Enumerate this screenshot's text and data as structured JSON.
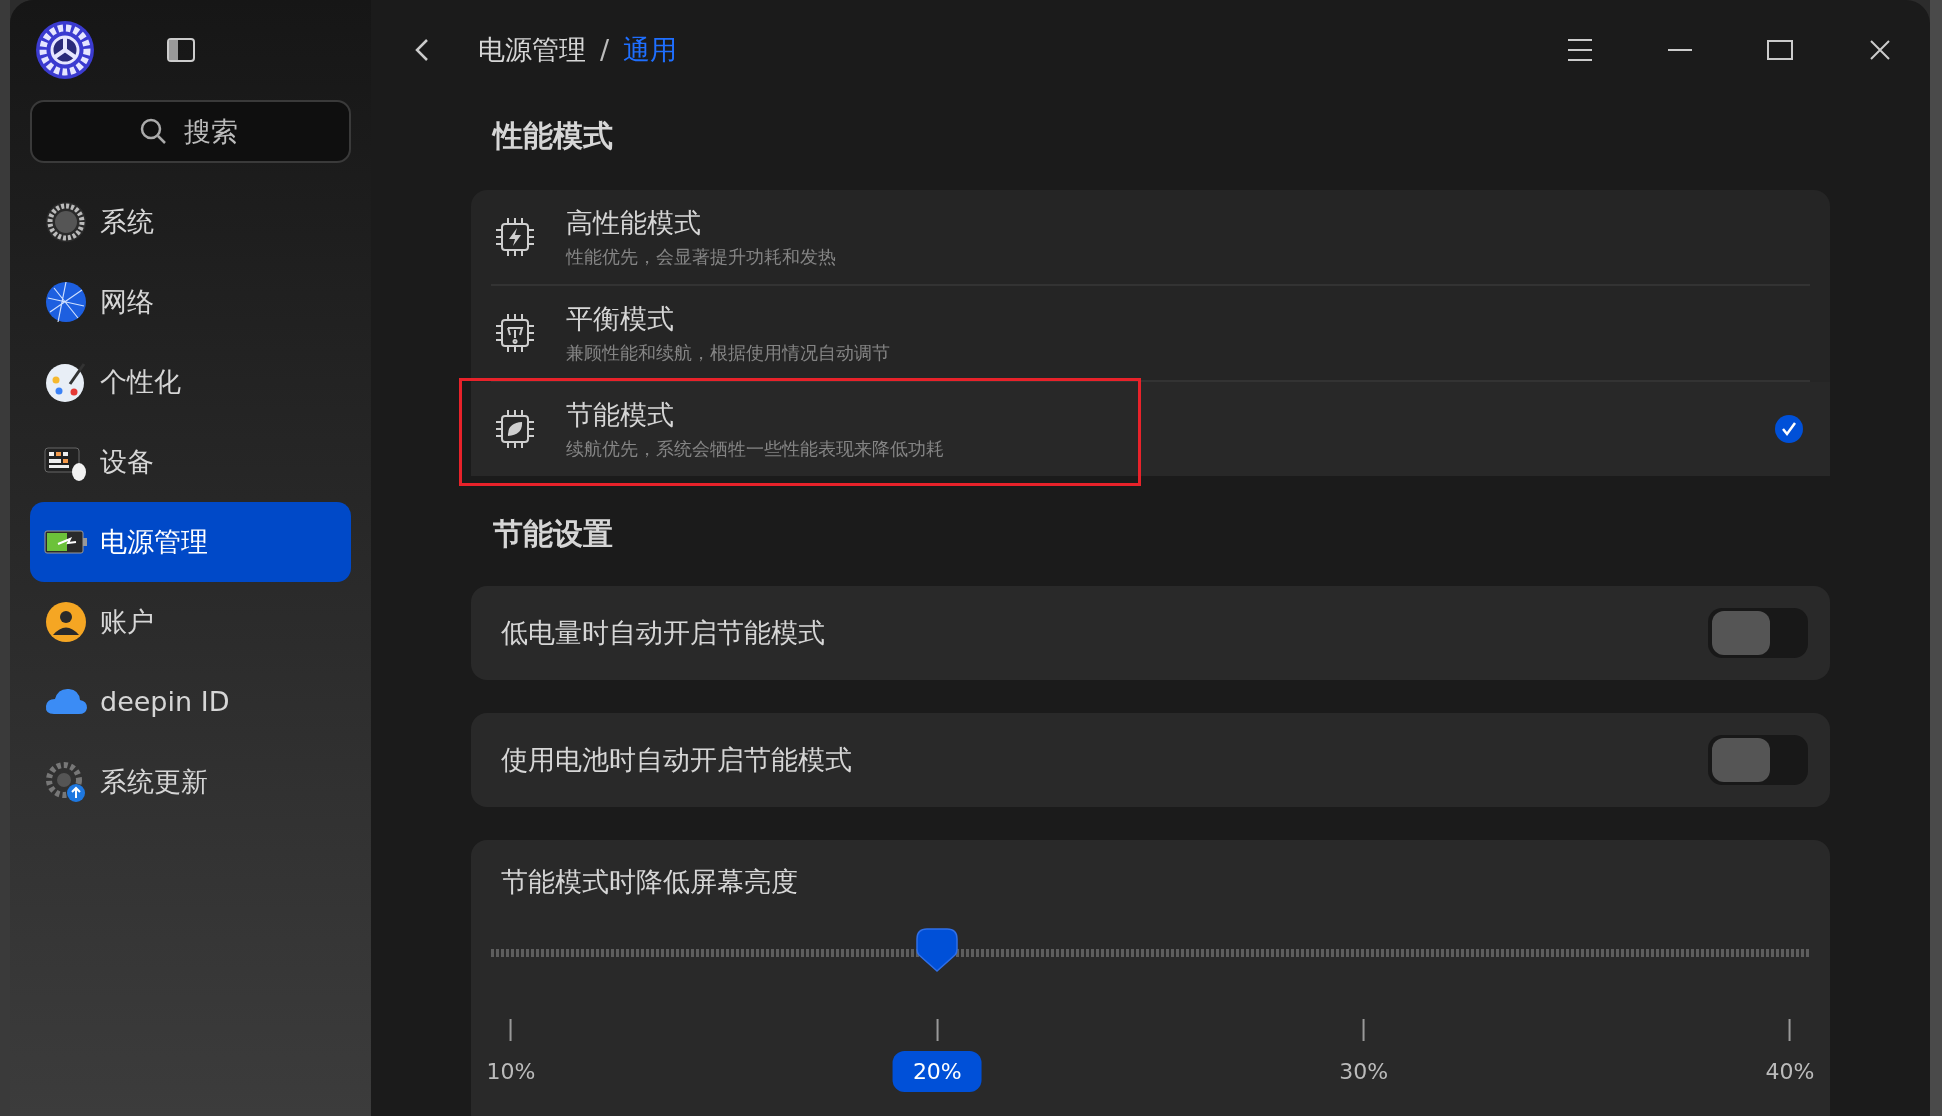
{
  "sidebar": {
    "search": {
      "placeholder": "搜索"
    },
    "items": [
      {
        "label": "系统",
        "selected": false
      },
      {
        "label": "网络",
        "selected": false
      },
      {
        "label": "个性化",
        "selected": false
      },
      {
        "label": "设备",
        "selected": false
      },
      {
        "label": "电源管理",
        "selected": true
      },
      {
        "label": "账户",
        "selected": false
      },
      {
        "label": "deepin ID",
        "selected": false
      },
      {
        "label": "系统更新",
        "selected": false
      }
    ]
  },
  "breadcrumb": {
    "items": [
      "电源管理",
      "通用"
    ],
    "separator": "/"
  },
  "performance": {
    "title": "性能模式",
    "modes": [
      {
        "title": "高性能模式",
        "description": "性能优先，会显著提升功耗和发热",
        "selected": false,
        "highlighted": false
      },
      {
        "title": "平衡模式",
        "description": "兼顾性能和续航，根据使用情况自动调节",
        "selected": false,
        "highlighted": false
      },
      {
        "title": "节能模式",
        "description": "续航优先，系统会牺牲一些性能表现来降低功耗",
        "selected": true,
        "highlighted": true
      }
    ]
  },
  "power_saving": {
    "title": "节能设置",
    "toggles": [
      {
        "label": "低电量时自动开启节能模式",
        "on": false
      },
      {
        "label": "使用电池时自动开启节能模式",
        "on": false
      }
    ],
    "brightness": {
      "label": "节能模式时降低屏幕亮度",
      "level": 0.333,
      "ticks": [
        {
          "label": "10%",
          "selected": false
        },
        {
          "label": "20%",
          "selected": true
        },
        {
          "label": "30%",
          "selected": false
        },
        {
          "label": "40%",
          "selected": false
        }
      ]
    }
  }
}
